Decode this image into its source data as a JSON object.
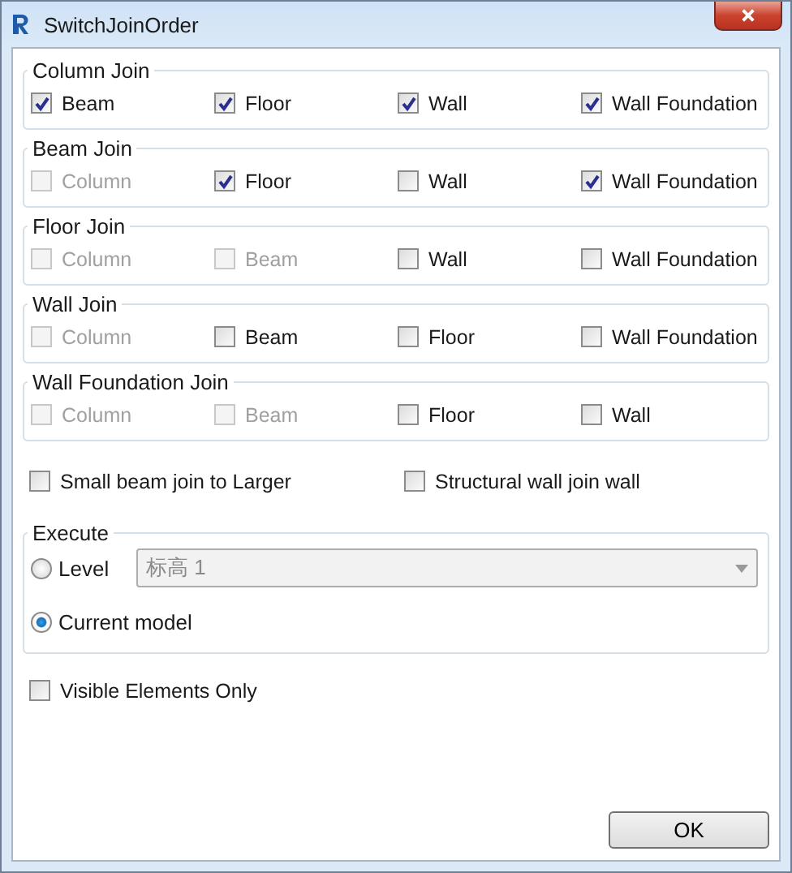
{
  "window": {
    "title": "SwitchJoinOrder"
  },
  "groups": [
    {
      "title": "Column Join",
      "options": [
        {
          "label": "Beam",
          "checked": true,
          "disabled": false
        },
        {
          "label": "Floor",
          "checked": true,
          "disabled": false
        },
        {
          "label": "Wall",
          "checked": true,
          "disabled": false
        },
        {
          "label": "Wall Foundation",
          "checked": true,
          "disabled": false
        }
      ]
    },
    {
      "title": "Beam Join",
      "options": [
        {
          "label": "Column",
          "checked": false,
          "disabled": true
        },
        {
          "label": "Floor",
          "checked": true,
          "disabled": false
        },
        {
          "label": "Wall",
          "checked": false,
          "disabled": false
        },
        {
          "label": "Wall Foundation",
          "checked": true,
          "disabled": false
        }
      ]
    },
    {
      "title": "Floor Join",
      "options": [
        {
          "label": "Column",
          "checked": false,
          "disabled": true
        },
        {
          "label": "Beam",
          "checked": false,
          "disabled": true
        },
        {
          "label": "Wall",
          "checked": false,
          "disabled": false
        },
        {
          "label": "Wall Foundation",
          "checked": false,
          "disabled": false
        }
      ]
    },
    {
      "title": "Wall Join",
      "options": [
        {
          "label": "Column",
          "checked": false,
          "disabled": true
        },
        {
          "label": "Beam",
          "checked": false,
          "disabled": false
        },
        {
          "label": "Floor",
          "checked": false,
          "disabled": false
        },
        {
          "label": "Wall Foundation",
          "checked": false,
          "disabled": false
        }
      ]
    },
    {
      "title": "Wall Foundation Join",
      "options": [
        {
          "label": "Column",
          "checked": false,
          "disabled": true
        },
        {
          "label": "Beam",
          "checked": false,
          "disabled": true
        },
        {
          "label": "Floor",
          "checked": false,
          "disabled": false
        },
        {
          "label": "Wall",
          "checked": false,
          "disabled": false
        }
      ]
    }
  ],
  "extra_options": [
    {
      "label": "Small beam join to Larger",
      "checked": false
    },
    {
      "label": "Structural wall join wall",
      "checked": false
    }
  ],
  "execute": {
    "title": "Execute",
    "modes": [
      {
        "label": "Level",
        "selected": false
      },
      {
        "label": "Current model",
        "selected": true
      }
    ],
    "level_dropdown": {
      "value": "标高 1",
      "disabled": true
    }
  },
  "visible_only": {
    "label": "Visible Elements Only",
    "checked": false
  },
  "buttons": [
    "OK"
  ]
}
